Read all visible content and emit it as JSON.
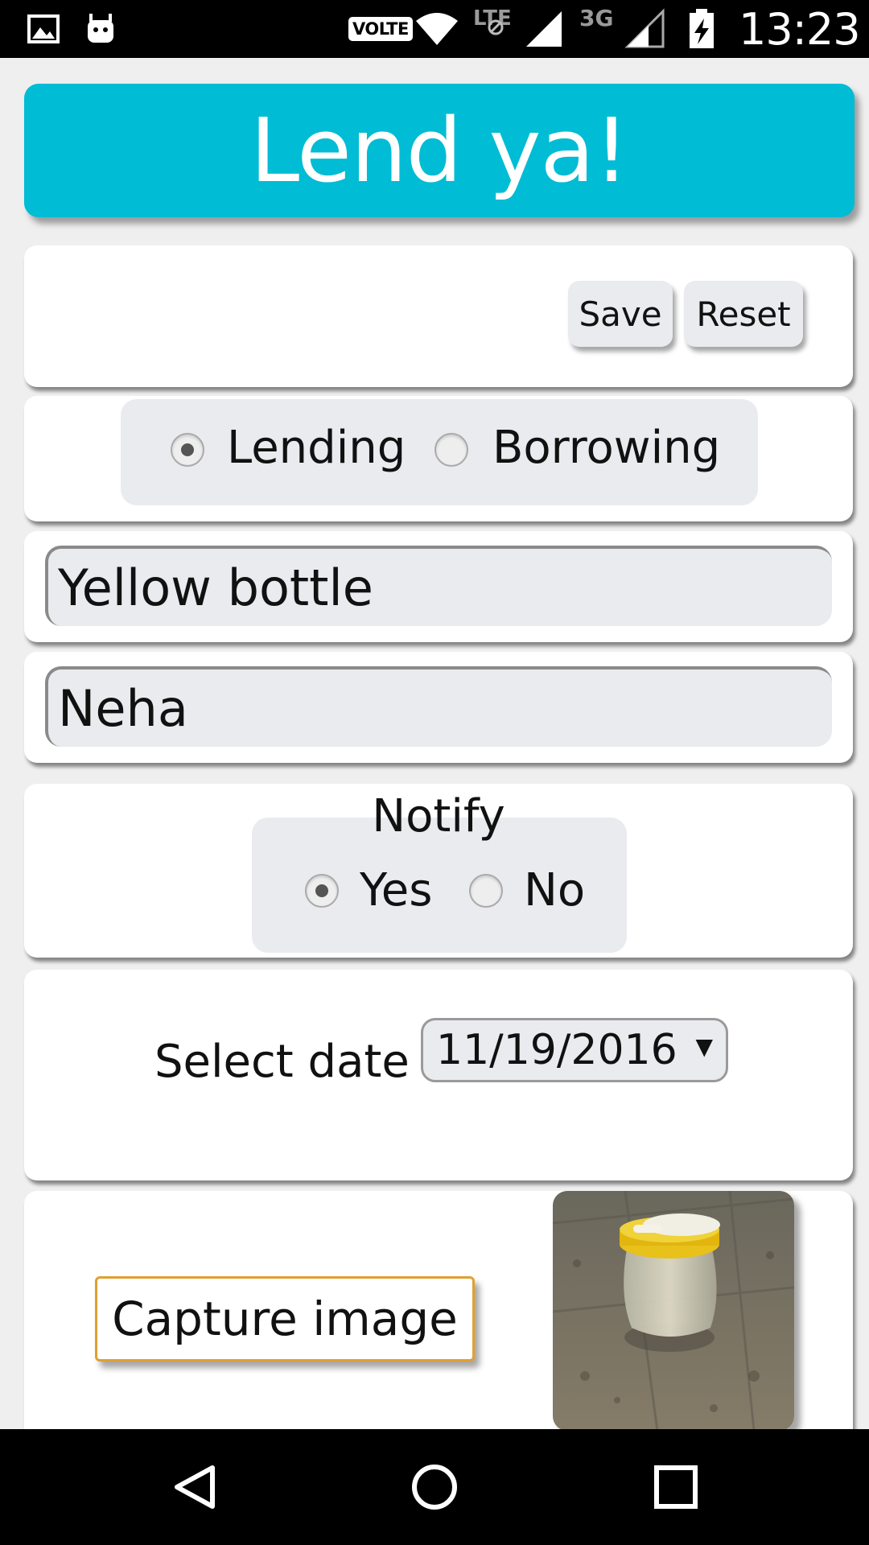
{
  "status_bar": {
    "volte": "VOLTE",
    "lte": "LTE",
    "three_g": "3G",
    "time": "13:23",
    "icons": [
      "image-icon",
      "android-icon",
      "wifi-icon",
      "signal-icon",
      "battery-charging-icon"
    ]
  },
  "app": {
    "title": "Lend ya!",
    "accent_color": "#00bcd4"
  },
  "actions": {
    "save_label": "Save",
    "reset_label": "Reset"
  },
  "mode": {
    "options": [
      {
        "label": "Lending",
        "selected": true
      },
      {
        "label": "Borrowing",
        "selected": false
      }
    ]
  },
  "item_field": {
    "value": "Yellow bottle"
  },
  "person_field": {
    "value": "Neha"
  },
  "notify": {
    "label": "Notify",
    "options": [
      {
        "label": "Yes",
        "selected": true
      },
      {
        "label": "No",
        "selected": false
      }
    ]
  },
  "date": {
    "label": "Select date",
    "value": "11/19/2016"
  },
  "image": {
    "capture_label": "Capture image",
    "thumbnail_icon": "photo-thumbnail"
  },
  "nav_bar": {
    "icons": [
      "back-icon",
      "home-icon",
      "recents-icon"
    ]
  }
}
